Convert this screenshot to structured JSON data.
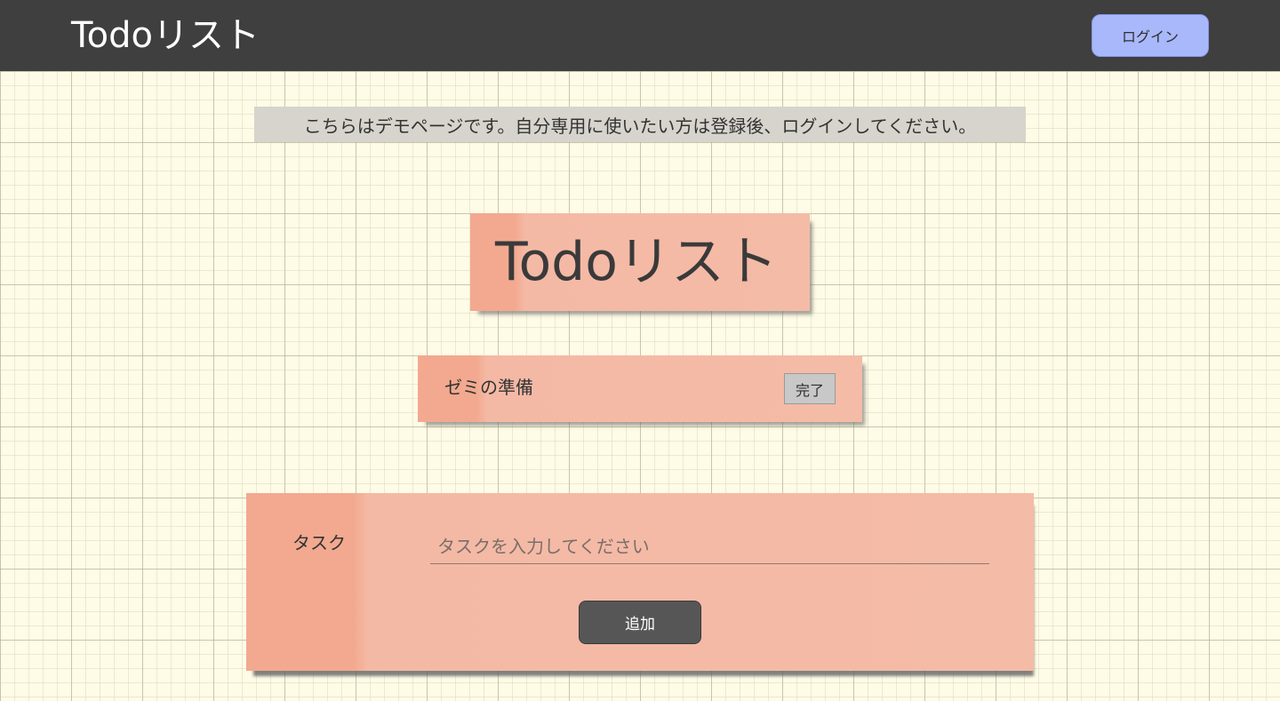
{
  "header": {
    "title": "Todoリスト",
    "login_label": "ログイン"
  },
  "notice": {
    "text": "こちらはデモページです。自分専用に使いたい方は登録後、ログインしてください。"
  },
  "main": {
    "title": "Todoリスト",
    "tasks": [
      {
        "text": "ゼミの準備",
        "done_label": "完了"
      }
    ]
  },
  "form": {
    "label": "タスク",
    "placeholder": "タスクを入力してください",
    "value": "",
    "add_label": "追加"
  },
  "colors": {
    "header_bg": "#3f3f3f",
    "login_button": "#a9b8fb",
    "sticky_note": "#f4bba7",
    "sticky_edge": "#f2a98f",
    "add_button": "#565656",
    "page_bg": "#fefbe6"
  }
}
